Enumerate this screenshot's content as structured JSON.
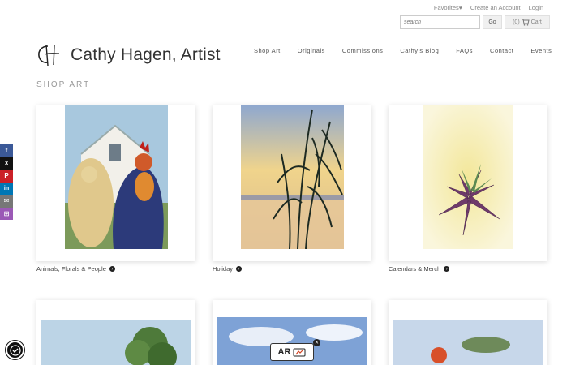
{
  "toplinks": {
    "favorites": "Favorites",
    "create_account": "Create an Account",
    "login": "Login"
  },
  "search": {
    "placeholder": "search",
    "go_label": "Go",
    "cart_label": "(0)",
    "cart_text": "Cart"
  },
  "site": {
    "title": "Cathy Hagen, Artist"
  },
  "nav": [
    "Shop Art",
    "Originals",
    "Commissions",
    "Cathy's Blog",
    "FAQs",
    "Contact",
    "Events"
  ],
  "section_title": "SHOP ART",
  "categories": [
    {
      "label": "Animals, Florals & People"
    },
    {
      "label": "Holiday"
    },
    {
      "label": "Calendars & Merch"
    }
  ],
  "share": [
    {
      "icon": "facebook-icon",
      "glyph": "f",
      "color": "#3b5998"
    },
    {
      "icon": "x-icon",
      "glyph": "X",
      "color": "#111111"
    },
    {
      "icon": "pinterest-icon",
      "glyph": "P",
      "color": "#cb2027"
    },
    {
      "icon": "linkedin-icon",
      "glyph": "in",
      "color": "#0077b5"
    },
    {
      "icon": "email-icon",
      "glyph": "✉",
      "color": "#777777"
    },
    {
      "icon": "gift-icon",
      "glyph": "⊞",
      "color": "#9b59b6"
    }
  ],
  "ar_badge": {
    "text": "AR"
  }
}
